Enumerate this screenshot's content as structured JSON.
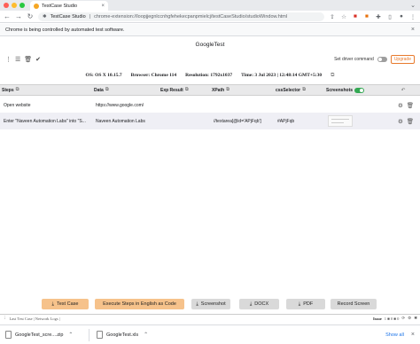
{
  "browser": {
    "tab_title": "TestCase Studio",
    "tab_close": "×",
    "tab_list_icon": "chevron-down-icon",
    "address_site": "TestCase Studio",
    "address_url": "chrome-extension://loopjjegnlccnhgfehekecpanpmielcj/testCaseStudio/studioWindow.html",
    "info_message": "Chrome is being controlled by automated test software.",
    "info_close": "×"
  },
  "app": {
    "page_title": "GoogleTest",
    "driver_command_label": "Set driver command",
    "upgrade_label": "Upgrade"
  },
  "environment": {
    "os": "OS: OS X 10.15.7",
    "browser": "Browser: Chrome 114",
    "resolution": "Resolution: 1792x1037",
    "time": "Time: 3 Jul 2023 | 12:48:14 GMT+5:30"
  },
  "table": {
    "headers": [
      "Steps",
      "Data",
      "Exp Result",
      "XPath",
      "cssSelector",
      "Screenshots"
    ],
    "rows": [
      {
        "steps": "Open website",
        "data": "https://www.google.com/",
        "exp_result": "",
        "xpath": "",
        "css": ""
      },
      {
        "steps": "Enter \"Naveen Automation Labs\" into \"S...",
        "data": "Naveen Automation Labs",
        "exp_result": "",
        "xpath": "//textarea[@id='APjFqb']",
        "css": "#APjFqb"
      }
    ]
  },
  "buttons": {
    "test_case": "Test Case",
    "execute": "Execute Steps in English as Code",
    "screenshot": "Screenshot",
    "docx": "DOCX",
    "pdf": "PDF",
    "record": "Record Screen"
  },
  "devtools": {
    "left_text": "Last Test Case | Network Logs |",
    "issue_label": "Issue",
    "counters": "1 ■ 0 ■ 0"
  },
  "downloads": {
    "items": [
      "GoogleTest_scre....zip",
      "GoogleTest.xls"
    ],
    "show_all": "Show all",
    "close": "×"
  },
  "colors": {
    "accent_orange": "#f6c28b",
    "toggle_on": "#34a853",
    "link_blue": "#1a73e8"
  }
}
